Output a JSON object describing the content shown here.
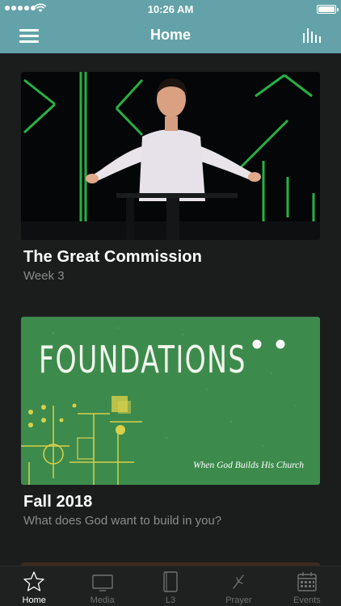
{
  "status_bar": {
    "time": "10:26 AM"
  },
  "header": {
    "title": "Home"
  },
  "cards": [
    {
      "title": "The Great Commission",
      "subtitle": "Week 3"
    },
    {
      "title": "Fall 2018",
      "subtitle": "What does God want to build in you?",
      "artwork_title": "FOUNDATIONS",
      "artwork_tagline": "When God Builds His Church"
    }
  ],
  "tabs": [
    {
      "label": "Home",
      "icon": "star-icon",
      "active": true
    },
    {
      "label": "Media",
      "icon": "tv-icon",
      "active": false
    },
    {
      "label": "L3",
      "icon": "book-icon",
      "active": false
    },
    {
      "label": "Prayer",
      "icon": "prayer-icon",
      "active": false
    },
    {
      "label": "Events",
      "icon": "calendar-icon",
      "active": false
    }
  ],
  "colors": {
    "header": "#63a2a8",
    "background": "#1b1c1c",
    "tabbar": "#1f2020",
    "artwork_green": "#3d8b4c"
  }
}
